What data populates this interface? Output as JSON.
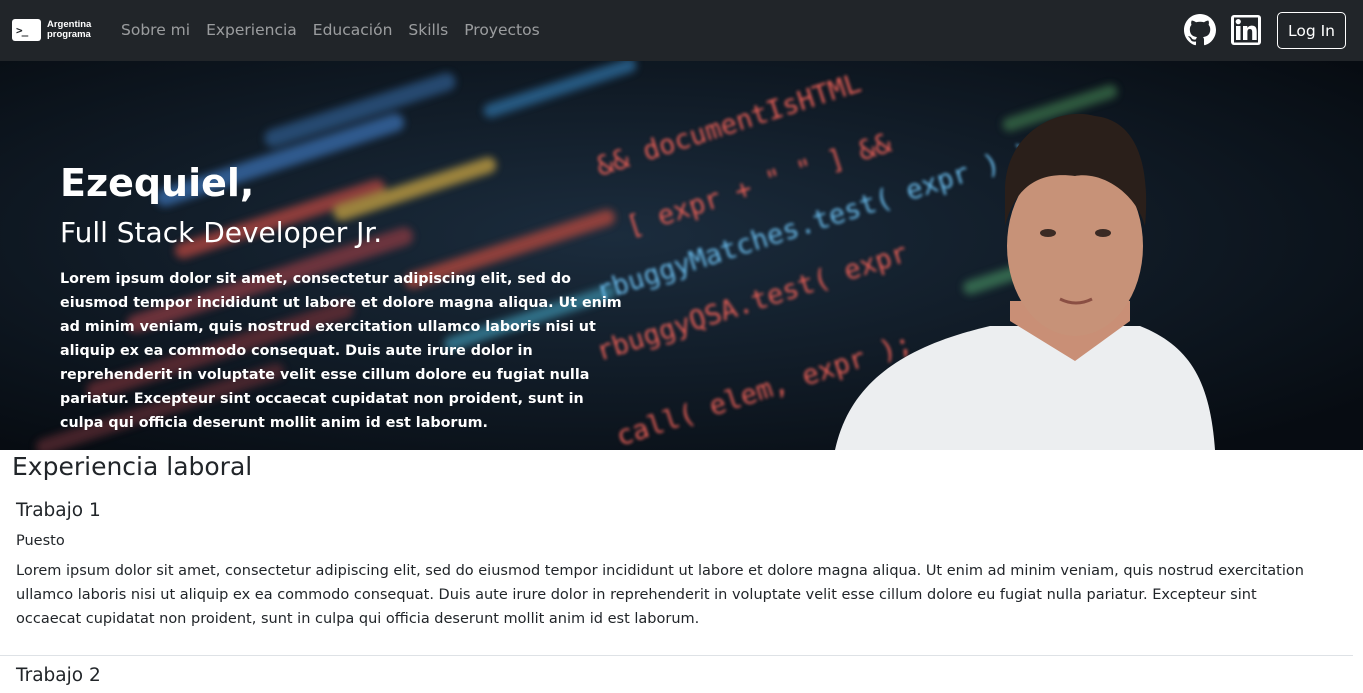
{
  "navbar": {
    "brand_symbol": ">_",
    "brand_line1": "Argentina",
    "brand_line2": "programa",
    "links": [
      "Sobre mi",
      "Experiencia",
      "Educación",
      "Skills",
      "Proyectos"
    ],
    "github_icon": "github-icon",
    "linkedin_icon": "linkedin-icon",
    "login_label": "Log In"
  },
  "hero": {
    "name": "Ezequiel,",
    "role": "Full Stack Developer Jr.",
    "description": "Lorem ipsum dolor sit amet, consectetur adipiscing elit, sed do eiusmod tempor incididunt ut labore et dolore magna aliqua. Ut enim ad minim veniam, quis nostrud exercitation ullamco laboris nisi ut aliquip ex ea commodo consequat. Duis aute irure dolor in reprehenderit in voluptate velit esse cillum dolore eu fugiat nulla pariatur. Excepteur sint occaecat cupidatat non proident, sunt in culpa qui officia deserunt mollit anim id est laborum.",
    "code_lines": [
      "documentIsHTML",
      "expr + \" \" ] &&",
      "rbuggyMatches.test( expr ) )",
      "rbuggyQSA.test( expr",
      "call( elem, expr );"
    ]
  },
  "experience": {
    "title": "Experiencia laboral",
    "jobs": [
      {
        "title": "Trabajo 1",
        "role": "Puesto",
        "description": "Lorem ipsum dolor sit amet, consectetur adipiscing elit, sed do eiusmod tempor incididunt ut labore et dolore magna aliqua. Ut enim ad minim veniam, quis nostrud exercitation ullamco laboris nisi ut aliquip ex ea commodo consequat. Duis aute irure dolor in reprehenderit in voluptate velit esse cillum dolore eu fugiat nulla pariatur. Excepteur sint occaecat cupidatat non proident, sunt in culpa qui officia deserunt mollit anim id est laborum."
      },
      {
        "title": "Trabajo 2"
      }
    ]
  },
  "colors": {
    "navbar_bg": "#212529",
    "hero_bg": "#0d1722",
    "text": "#212529"
  }
}
